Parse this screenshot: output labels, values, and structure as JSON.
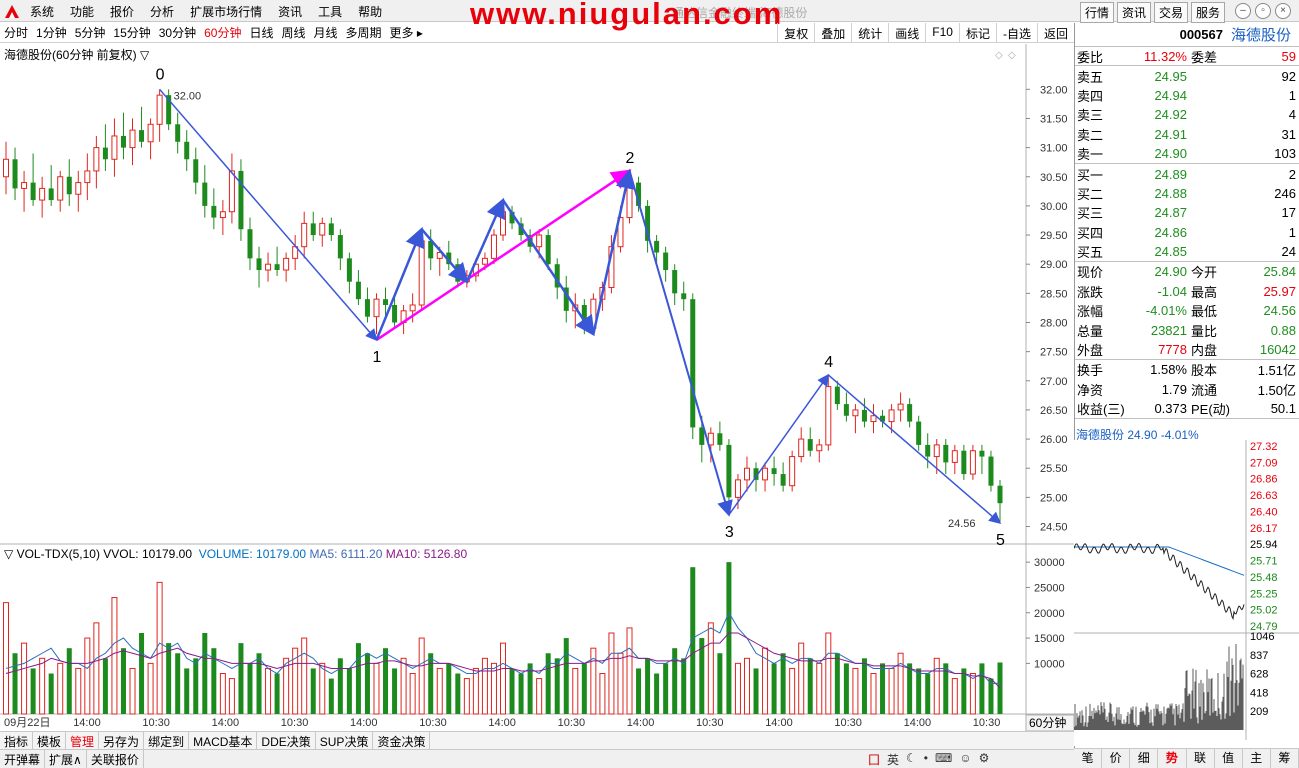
{
  "menubar": {
    "items": [
      "系统",
      "功能",
      "报价",
      "分析",
      "扩展市场行情",
      "资讯",
      "工具",
      "帮助"
    ],
    "watermark": "www.niugulan.com",
    "faint_title": "通达信金融终端  海德股份",
    "right_buttons": [
      "行情",
      "资讯",
      "交易",
      "服务"
    ]
  },
  "toolbar": {
    "periods": [
      "分时",
      "1分钟",
      "5分钟",
      "15分钟",
      "30分钟",
      "60分钟",
      "日线",
      "周线",
      "月线",
      "多周期",
      "更多"
    ],
    "active_period": "60分钟",
    "right": [
      "复权",
      "叠加",
      "统计",
      "画线",
      "F10",
      "标记",
      "-自选",
      "返回"
    ]
  },
  "chart": {
    "title": "海德股份(60分钟 前复权)",
    "y_ticks": [
      "32.00",
      "31.50",
      "31.00",
      "30.50",
      "30.00",
      "29.50",
      "29.00",
      "28.50",
      "28.00",
      "27.50",
      "27.00",
      "26.50",
      "26.00",
      "25.50",
      "25.00",
      "24.50"
    ],
    "high_label": "32.00",
    "low_label": "24.56",
    "wave_labels": [
      "0",
      "1",
      "2",
      "3",
      "4",
      "5"
    ],
    "x_ticks": [
      "09月22日",
      "14:00",
      "10:30",
      "14:00",
      "10:30",
      "14:00",
      "10:30",
      "14:00",
      "10:30",
      "14:00",
      "10:30",
      "14:00",
      "10:30",
      "14:00",
      "10:30"
    ],
    "period_label": "60分钟"
  },
  "volume": {
    "title": "VOL-TDX(5,10)",
    "vvol": "VVOL: 10179.00",
    "volume": "VOLUME: 10179.00",
    "ma5": "MA5: 6111.20",
    "ma10": "MA10: 5126.80",
    "y_ticks": [
      "30000",
      "25000",
      "20000",
      "15000",
      "10000"
    ]
  },
  "bottom_tabs": [
    "指标",
    "模板",
    "管理",
    "另存为",
    "绑定到",
    "MACD基本",
    "DDE决策",
    "SUP决策",
    "资金决策"
  ],
  "active_bottom_tab": "管理",
  "status": [
    "开弹幕",
    "扩展∧",
    "关联报价"
  ],
  "ime": [
    "英"
  ],
  "quote": {
    "code": "000567",
    "name": "海德股份",
    "ratio_label": "委比",
    "ratio": "11.32%",
    "diff_label": "委差",
    "diff": "59",
    "asks": [
      {
        "label": "卖五",
        "price": "24.95",
        "vol": "92"
      },
      {
        "label": "卖四",
        "price": "24.94",
        "vol": "1"
      },
      {
        "label": "卖三",
        "price": "24.92",
        "vol": "4"
      },
      {
        "label": "卖二",
        "price": "24.91",
        "vol": "31"
      },
      {
        "label": "卖一",
        "price": "24.90",
        "vol": "103"
      }
    ],
    "bids": [
      {
        "label": "买一",
        "price": "24.89",
        "vol": "2"
      },
      {
        "label": "买二",
        "price": "24.88",
        "vol": "246"
      },
      {
        "label": "买三",
        "price": "24.87",
        "vol": "17"
      },
      {
        "label": "买四",
        "price": "24.86",
        "vol": "1"
      },
      {
        "label": "买五",
        "price": "24.85",
        "vol": "24"
      }
    ],
    "stats": [
      {
        "l1": "现价",
        "v1": "24.90",
        "c1": "grn",
        "l2": "今开",
        "v2": "25.84",
        "c2": "grn"
      },
      {
        "l1": "涨跌",
        "v1": "-1.04",
        "c1": "grn",
        "l2": "最高",
        "v2": "25.97",
        "c2": "red"
      },
      {
        "l1": "涨幅",
        "v1": "-4.01%",
        "c1": "grn",
        "l2": "最低",
        "v2": "24.56",
        "c2": "grn"
      },
      {
        "l1": "总量",
        "v1": "23821",
        "c1": "grn",
        "l2": "量比",
        "v2": "0.88",
        "c2": "grn"
      },
      {
        "l1": "外盘",
        "v1": "7778",
        "c1": "red",
        "l2": "内盘",
        "v2": "16042",
        "c2": "grn"
      }
    ],
    "stats2": [
      {
        "l1": "换手",
        "v1": "1.58%",
        "l2": "股本",
        "v2": "1.51亿"
      },
      {
        "l1": "净资",
        "v1": "1.79",
        "l2": "流通",
        "v2": "1.50亿"
      },
      {
        "l1": "收益(三)",
        "v1": "0.373",
        "l2": "PE(动)",
        "v2": "50.1"
      }
    ]
  },
  "mini": {
    "title": "海德股份  24.90  -4.01%",
    "price_ticks": [
      "27.32",
      "27.09",
      "26.86",
      "26.63",
      "26.40",
      "26.17",
      "25.94",
      "25.71",
      "25.48",
      "25.25",
      "25.02",
      "24.79"
    ],
    "vol_ticks": [
      "1046",
      "837",
      "628",
      "418",
      "209"
    ],
    "tabs": [
      "笔",
      "价",
      "细",
      "势",
      "联",
      "值",
      "主",
      "筹"
    ],
    "active_tab": "势"
  },
  "chart_data": {
    "type": "candlestick",
    "title": "海德股份(60分钟 前复权)",
    "ylim": [
      24.2,
      32.4
    ],
    "waves": [
      {
        "label": "0",
        "price": 32.0
      },
      {
        "label": "1",
        "price": 27.7
      },
      {
        "label": "2",
        "price": 30.6
      },
      {
        "label": "3",
        "price": 24.7
      },
      {
        "label": "4",
        "price": 27.1
      },
      {
        "label": "5",
        "price": 24.56
      }
    ],
    "volume_ylim": [
      0,
      32000
    ],
    "candles": [
      [
        30.5,
        31.1,
        30.2,
        30.8
      ],
      [
        30.8,
        31.0,
        30.1,
        30.3
      ],
      [
        30.3,
        30.6,
        29.9,
        30.4
      ],
      [
        30.4,
        30.9,
        30.0,
        30.1
      ],
      [
        30.1,
        30.5,
        29.8,
        30.3
      ],
      [
        30.3,
        30.7,
        30.0,
        30.1
      ],
      [
        30.1,
        30.6,
        29.9,
        30.5
      ],
      [
        30.5,
        30.8,
        30.0,
        30.2
      ],
      [
        30.2,
        30.6,
        29.9,
        30.4
      ],
      [
        30.4,
        30.9,
        30.1,
        30.6
      ],
      [
        30.6,
        31.2,
        30.3,
        31.0
      ],
      [
        31.0,
        31.4,
        30.6,
        30.8
      ],
      [
        30.8,
        31.5,
        30.5,
        31.2
      ],
      [
        31.2,
        31.6,
        30.8,
        31.0
      ],
      [
        31.0,
        31.5,
        30.7,
        31.3
      ],
      [
        31.3,
        31.7,
        31.0,
        31.1
      ],
      [
        31.1,
        31.5,
        30.8,
        31.4
      ],
      [
        31.4,
        32.0,
        31.1,
        31.9
      ],
      [
        31.9,
        32.0,
        31.3,
        31.4
      ],
      [
        31.4,
        31.6,
        30.9,
        31.1
      ],
      [
        31.1,
        31.3,
        30.6,
        30.8
      ],
      [
        30.8,
        31.0,
        30.2,
        30.4
      ],
      [
        30.4,
        30.7,
        29.8,
        30.0
      ],
      [
        30.0,
        30.3,
        29.6,
        29.8
      ],
      [
        29.8,
        30.1,
        29.5,
        29.9
      ],
      [
        29.9,
        30.9,
        29.7,
        30.6
      ],
      [
        30.6,
        30.8,
        29.4,
        29.6
      ],
      [
        29.6,
        29.8,
        28.9,
        29.1
      ],
      [
        29.1,
        29.3,
        28.6,
        28.9
      ],
      [
        28.9,
        29.2,
        28.7,
        29.0
      ],
      [
        29.0,
        29.3,
        28.8,
        28.9
      ],
      [
        28.9,
        29.2,
        28.7,
        29.1
      ],
      [
        29.1,
        29.5,
        28.9,
        29.3
      ],
      [
        29.3,
        29.9,
        29.1,
        29.7
      ],
      [
        29.7,
        29.9,
        29.4,
        29.5
      ],
      [
        29.5,
        29.8,
        29.3,
        29.7
      ],
      [
        29.7,
        29.8,
        29.4,
        29.5
      ],
      [
        29.5,
        29.6,
        28.9,
        29.1
      ],
      [
        29.1,
        29.2,
        28.5,
        28.7
      ],
      [
        28.7,
        28.9,
        28.3,
        28.4
      ],
      [
        28.4,
        28.6,
        28.0,
        28.1
      ],
      [
        28.1,
        28.5,
        27.8,
        28.4
      ],
      [
        28.4,
        28.6,
        28.1,
        28.3
      ],
      [
        28.3,
        28.5,
        27.9,
        28.0
      ],
      [
        28.0,
        28.3,
        27.8,
        28.2
      ],
      [
        28.2,
        28.5,
        28.0,
        28.3
      ],
      [
        28.3,
        29.6,
        28.2,
        29.4
      ],
      [
        29.4,
        29.6,
        28.9,
        29.1
      ],
      [
        29.1,
        29.3,
        28.8,
        29.2
      ],
      [
        29.2,
        29.4,
        28.9,
        29.0
      ],
      [
        29.0,
        29.1,
        28.6,
        28.7
      ],
      [
        28.7,
        28.9,
        28.6,
        28.8
      ],
      [
        28.8,
        29.1,
        28.7,
        29.0
      ],
      [
        29.0,
        29.2,
        28.9,
        29.1
      ],
      [
        29.1,
        29.6,
        29.0,
        29.5
      ],
      [
        29.5,
        30.1,
        29.4,
        29.9
      ],
      [
        29.9,
        30.0,
        29.6,
        29.7
      ],
      [
        29.7,
        29.8,
        29.4,
        29.5
      ],
      [
        29.5,
        29.6,
        29.2,
        29.3
      ],
      [
        29.3,
        29.6,
        29.1,
        29.5
      ],
      [
        29.5,
        29.6,
        28.9,
        29.0
      ],
      [
        29.0,
        29.1,
        28.4,
        28.6
      ],
      [
        28.6,
        28.8,
        28.0,
        28.2
      ],
      [
        28.2,
        28.5,
        27.9,
        28.3
      ],
      [
        28.3,
        28.4,
        27.8,
        27.9
      ],
      [
        27.9,
        28.5,
        27.8,
        28.4
      ],
      [
        28.4,
        28.7,
        28.2,
        28.6
      ],
      [
        28.6,
        29.5,
        28.5,
        29.3
      ],
      [
        29.3,
        30.0,
        29.2,
        29.8
      ],
      [
        29.8,
        30.6,
        29.7,
        30.4
      ],
      [
        30.4,
        30.5,
        29.9,
        30.0
      ],
      [
        30.0,
        30.1,
        29.2,
        29.4
      ],
      [
        29.4,
        29.5,
        29.0,
        29.2
      ],
      [
        29.2,
        29.3,
        28.7,
        28.9
      ],
      [
        28.9,
        29.0,
        28.3,
        28.5
      ],
      [
        28.5,
        28.7,
        28.2,
        28.4
      ],
      [
        28.4,
        28.5,
        26.0,
        26.2
      ],
      [
        26.2,
        26.4,
        25.6,
        25.9
      ],
      [
        25.9,
        26.2,
        25.6,
        26.1
      ],
      [
        26.1,
        26.3,
        25.8,
        25.9
      ],
      [
        25.9,
        26.0,
        24.7,
        25.0
      ],
      [
        25.0,
        25.4,
        24.8,
        25.3
      ],
      [
        25.3,
        25.7,
        25.1,
        25.5
      ],
      [
        25.5,
        25.6,
        25.1,
        25.3
      ],
      [
        25.3,
        25.6,
        25.1,
        25.5
      ],
      [
        25.5,
        25.7,
        25.2,
        25.4
      ],
      [
        25.4,
        25.6,
        25.1,
        25.2
      ],
      [
        25.2,
        25.8,
        25.1,
        25.7
      ],
      [
        25.7,
        26.2,
        25.6,
        26.0
      ],
      [
        26.0,
        26.2,
        25.7,
        25.8
      ],
      [
        25.8,
        26.0,
        25.6,
        25.9
      ],
      [
        25.9,
        27.1,
        25.8,
        26.9
      ],
      [
        26.9,
        27.0,
        26.5,
        26.6
      ],
      [
        26.6,
        26.8,
        26.3,
        26.4
      ],
      [
        26.4,
        26.6,
        26.1,
        26.5
      ],
      [
        26.5,
        26.7,
        26.2,
        26.3
      ],
      [
        26.3,
        26.6,
        26.1,
        26.4
      ],
      [
        26.4,
        26.5,
        26.2,
        26.3
      ],
      [
        26.3,
        26.6,
        26.1,
        26.5
      ],
      [
        26.5,
        26.8,
        26.3,
        26.6
      ],
      [
        26.6,
        26.7,
        26.2,
        26.3
      ],
      [
        26.3,
        26.4,
        25.8,
        25.9
      ],
      [
        25.9,
        26.1,
        25.5,
        25.7
      ],
      [
        25.7,
        26.0,
        25.4,
        25.9
      ],
      [
        25.9,
        26.0,
        25.4,
        25.6
      ],
      [
        25.6,
        25.9,
        25.4,
        25.8
      ],
      [
        25.8,
        25.9,
        25.3,
        25.4
      ],
      [
        25.4,
        25.9,
        25.3,
        25.8
      ],
      [
        25.8,
        25.9,
        25.4,
        25.7
      ],
      [
        25.7,
        25.8,
        25.1,
        25.2
      ],
      [
        25.2,
        25.3,
        24.56,
        24.9
      ]
    ],
    "volumes": [
      22000,
      12000,
      14000,
      9000,
      11000,
      8000,
      10000,
      13000,
      9000,
      15000,
      18000,
      11000,
      23000,
      13000,
      9000,
      16000,
      10000,
      26000,
      14000,
      12000,
      9000,
      11000,
      16000,
      13000,
      8000,
      7000,
      14000,
      10000,
      12000,
      9000,
      8000,
      11000,
      13000,
      15000,
      9000,
      10000,
      7000,
      11000,
      9000,
      14000,
      12000,
      10000,
      13000,
      9000,
      11000,
      8000,
      15000,
      12000,
      9000,
      10000,
      8000,
      7000,
      9000,
      11000,
      10000,
      14000,
      9000,
      8000,
      10000,
      7000,
      12000,
      11000,
      15000,
      9000,
      10000,
      13000,
      8000,
      16000,
      12000,
      17000,
      9000,
      11000,
      8000,
      10000,
      13000,
      11000,
      29000,
      15000,
      18000,
      12000,
      30000,
      10000,
      11000,
      9000,
      13000,
      10000,
      12000,
      9000,
      14000,
      11000,
      10000,
      16000,
      12000,
      10000,
      9000,
      11000,
      8000,
      10000,
      9000,
      12000,
      10000,
      9000,
      8000,
      11000,
      10000,
      7000,
      9000,
      8000,
      10000,
      7000,
      10179
    ],
    "ma5": [
      9000,
      9500,
      10000,
      11000,
      12000,
      13000,
      10500,
      10000,
      10000,
      9000,
      11000,
      12000,
      14000,
      15000,
      13000,
      12000,
      11000,
      14000,
      13000,
      14000,
      11000,
      10000,
      12000,
      11000,
      10000,
      9000,
      10000,
      10000,
      11000,
      9000,
      8000,
      10000,
      11000,
      12000,
      11000,
      9000,
      8000,
      9000,
      9000,
      11000,
      12000,
      11000,
      12000,
      11000,
      10000,
      9000,
      10000,
      11000,
      10000,
      10000,
      9000,
      8000,
      8000,
      9000,
      9000,
      10000,
      9000,
      8000,
      9000,
      8000,
      10000,
      10000,
      12000,
      11000,
      10000,
      11000,
      10000,
      12000,
      12000,
      13000,
      11000,
      11000,
      10000,
      10000,
      11000,
      10000,
      15000,
      16000,
      17000,
      16000,
      20000,
      17000,
      15000,
      12000,
      11000,
      10000,
      11000,
      10000,
      11000,
      11000,
      10000,
      12000,
      12000,
      11000,
      10000,
      10000,
      9000,
      9000,
      9000,
      10000,
      9000,
      8000,
      8000,
      9000,
      9000,
      8000,
      8000,
      7000,
      8000,
      6000,
      6111
    ],
    "ma10": [
      8000,
      8500,
      9000,
      9500,
      10000,
      11000,
      10500,
      10000,
      10000,
      10000,
      10500,
      11000,
      12000,
      12500,
      12000,
      11500,
      11000,
      12000,
      12500,
      13000,
      12000,
      11500,
      11000,
      11000,
      10500,
      10000,
      10000,
      10000,
      10000,
      9500,
      9000,
      9500,
      10000,
      10000,
      10000,
      9500,
      9000,
      9000,
      9000,
      9500,
      10000,
      10000,
      10500,
      10500,
      10000,
      9500,
      9500,
      10000,
      10000,
      10000,
      9500,
      9000,
      8500,
      8500,
      8500,
      9000,
      9000,
      8500,
      8500,
      8500,
      9000,
      9500,
      10000,
      10000,
      10000,
      10500,
      10500,
      11000,
      11000,
      11500,
      11000,
      11000,
      10500,
      10500,
      10500,
      10500,
      12000,
      13000,
      14000,
      14000,
      16000,
      16000,
      15000,
      14000,
      13000,
      12000,
      11500,
      11000,
      10500,
      10500,
      10500,
      11000,
      11000,
      10500,
      10000,
      10000,
      9500,
      9500,
      9500,
      9500,
      9000,
      8500,
      8500,
      8500,
      8500,
      8000,
      8000,
      7500,
      7500,
      7000,
      5127
    ]
  }
}
